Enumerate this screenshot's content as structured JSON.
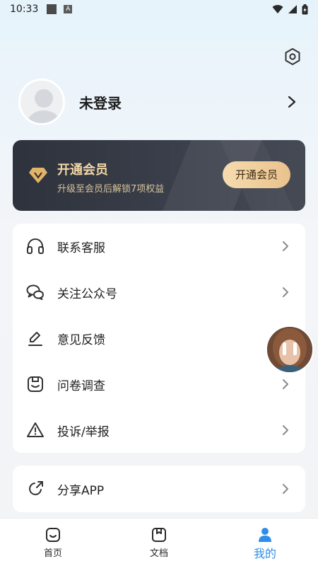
{
  "status_bar": {
    "time": "10:33",
    "notif_letter": "A"
  },
  "profile": {
    "login_text": "未登录"
  },
  "vip": {
    "title": "开通会员",
    "subtitle": "升级至会员后解锁7项权益",
    "button_label": "开通会员",
    "accent": "#f2d7a6"
  },
  "menu": {
    "items": [
      {
        "label": "联系客服",
        "icon": "headset-icon"
      },
      {
        "label": "关注公众号",
        "icon": "wechat-icon"
      },
      {
        "label": "意见反馈",
        "icon": "pen-icon"
      },
      {
        "label": "问卷调查",
        "icon": "survey-icon"
      },
      {
        "label": "投诉/举报",
        "icon": "warning-icon"
      }
    ]
  },
  "share": {
    "label": "分享APP",
    "icon": "share-icon"
  },
  "tabs": [
    {
      "label": "首页",
      "icon": "home-icon",
      "active": false
    },
    {
      "label": "文档",
      "icon": "document-icon",
      "active": false
    },
    {
      "label": "我的",
      "icon": "profile-icon",
      "active": true
    }
  ],
  "colors": {
    "active_tab": "#2f8ee8",
    "vip_card": "#2e323c"
  }
}
